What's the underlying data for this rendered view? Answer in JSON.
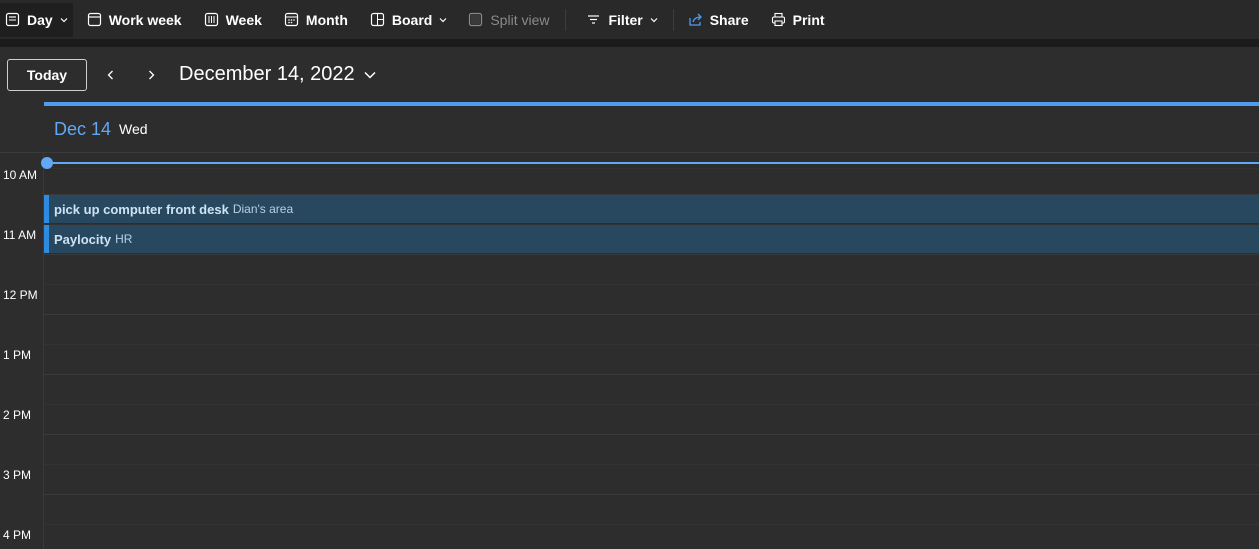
{
  "toolbar": {
    "day": "Day",
    "work_week": "Work week",
    "week": "Week",
    "month": "Month",
    "board": "Board",
    "split_view": "Split view",
    "filter": "Filter",
    "share": "Share",
    "print": "Print"
  },
  "nav": {
    "today": "Today",
    "date": "December 14, 2022"
  },
  "day_header": {
    "date": "Dec 14",
    "weekday": "Wed"
  },
  "time_labels": [
    "10 AM",
    "11 AM",
    "12 PM",
    "1 PM",
    "2 PM",
    "3 PM",
    "4 PM"
  ],
  "events": [
    {
      "title": "pick up computer front desk",
      "location": "Dian's area"
    },
    {
      "title": "Paylocity",
      "location": "HR"
    }
  ],
  "colors": {
    "accent": "#4f9bf0",
    "event_bg": "#284860",
    "event_bar": "#2f8be0"
  }
}
